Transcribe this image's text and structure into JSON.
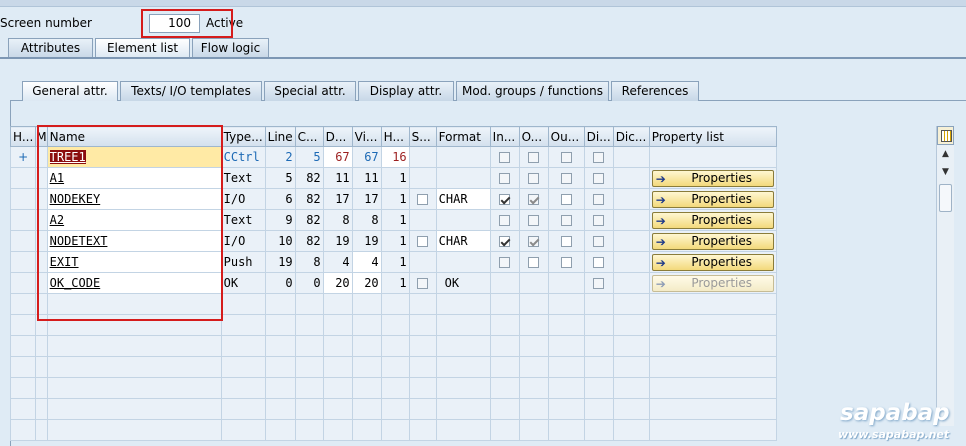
{
  "header": {
    "screen_number_label": "Screen number",
    "screen_number_value": "100",
    "status": "Active"
  },
  "top_tabs": [
    {
      "label": "Attributes",
      "active": false
    },
    {
      "label": "Element list",
      "active": true
    },
    {
      "label": "Flow logic",
      "active": false
    }
  ],
  "sub_tabs": [
    {
      "label": "General attr.",
      "active": true
    },
    {
      "label": "Texts/ I/O templates",
      "active": false
    },
    {
      "label": "Special attr.",
      "active": false
    },
    {
      "label": "Display attr.",
      "active": false
    },
    {
      "label": "Mod. groups / functions",
      "active": false
    },
    {
      "label": "References",
      "active": false
    }
  ],
  "columns": [
    "H...",
    "M",
    "Name",
    "Type...",
    "Line",
    "C...",
    "D...",
    "Vi...",
    "H...",
    "S...",
    "Format",
    "In...",
    "O...",
    "Ou...",
    "Di...",
    "Dic...",
    "Property list"
  ],
  "rows": [
    {
      "marker": "+",
      "name": "TREE1",
      "type": "CCtrl",
      "line": "2",
      "col": "5",
      "def": "67",
      "vis": "67",
      "height": "16",
      "format": "",
      "property": ""
    },
    {
      "marker": "",
      "name": "A1",
      "type": "Text",
      "line": "5",
      "col": "82",
      "def": "11",
      "vis": "11",
      "height": "1",
      "format": "",
      "property": "Properties"
    },
    {
      "marker": "",
      "name": "NODEKEY",
      "type": "I/O",
      "line": "6",
      "col": "82",
      "def": "17",
      "vis": "17",
      "height": "1",
      "format": "CHAR",
      "property": "Properties"
    },
    {
      "marker": "",
      "name": "A2",
      "type": "Text",
      "line": "9",
      "col": "82",
      "def": "8",
      "vis": "8",
      "height": "1",
      "format": "",
      "property": "Properties"
    },
    {
      "marker": "",
      "name": "NODETEXT",
      "type": "I/O",
      "line": "10",
      "col": "82",
      "def": "19",
      "vis": "19",
      "height": "1",
      "format": "CHAR",
      "property": "Properties"
    },
    {
      "marker": "",
      "name": "EXIT",
      "type": "Push",
      "line": "19",
      "col": "8",
      "def": "4",
      "vis": "4",
      "height": "1",
      "format": "",
      "property": "Properties"
    },
    {
      "marker": "",
      "name": "OK_CODE",
      "type": "OK",
      "line": "0",
      "col": "0",
      "def": "20",
      "vis": "20",
      "height": "1",
      "format": "OK",
      "property": "Properties"
    }
  ],
  "watermark": {
    "brand": "sapabap",
    "url": "www.sapabap.net"
  },
  "icons": {
    "config": "table-settings-icon",
    "scroll_up": "scroll-up-icon",
    "scroll_down": "scroll-down-icon",
    "arrow": "arrow-right-icon"
  }
}
